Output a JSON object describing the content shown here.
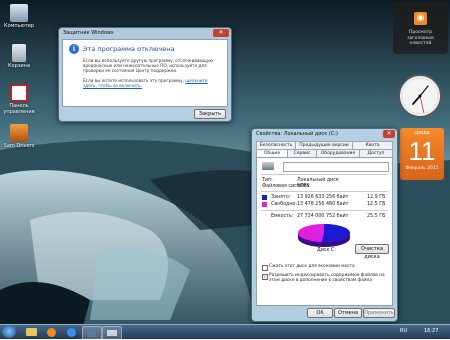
{
  "desktop": {
    "icons": [
      {
        "label": "Компьютер"
      },
      {
        "label": "Корзина"
      },
      {
        "label": "Панель управления"
      },
      {
        "label": "Sam Drivers"
      }
    ]
  },
  "gadgets": {
    "rss_text": "Просмотр заголовков новостей",
    "calendar": {
      "weekday": "среда",
      "day": "11",
      "month_year": "Февраль 2015"
    }
  },
  "defender_dialog": {
    "title": "Защитник Windows",
    "close_label": "✕",
    "heading": "Эта программа отключена",
    "body1": "Если вы используете другую программу, отслеживающую вредоносные или нежелательные ПО, используйте для проверки ее состояния Центр поддержки.",
    "body2": "Если вы хотите использовать эту программу,",
    "link": "щелкните здесь, чтобы ее включить.",
    "ok_label": "Закрыть"
  },
  "properties_dialog": {
    "title": "Свойства: Локальный диск (C:)",
    "close_label": "✕",
    "tabs_row1": [
      "Безопасность",
      "Предыдущие версии",
      "Квота"
    ],
    "tabs_row2": [
      "Общие",
      "Сервис",
      "Оборудование",
      "Доступ"
    ],
    "type_label": "Тип:",
    "type_value": "Локальный диск",
    "fs_label": "Файловая система:",
    "fs_value": "NTFS",
    "used_label": "Занято:",
    "used_bytes": "13 926 633 256 байт",
    "used_gb": "12,9 ГБ",
    "free_label": "Свободно:",
    "free_bytes": "13 478 256 480 байт",
    "free_gb": "12,5 ГБ",
    "cap_label": "Емкость:",
    "cap_bytes": "27 734 000 752 байт",
    "cap_gb": "25,5 ГБ",
    "disk_label": "Диск C:",
    "cleanup_label": "Очистка диска",
    "cb_compress": "Сжать этот диск для экономии места",
    "cb_index": "Разрешить индексировать содержимое файлов на этом диске в дополнение к свойствам файла",
    "buttons": [
      "OK",
      "Отмена",
      "Применить"
    ],
    "colors": {
      "used": "#1a1ad0",
      "free": "#e020e0"
    },
    "used_fraction": 0.514
  },
  "taskbar": {
    "time": "16:27",
    "lang": "RU"
  }
}
